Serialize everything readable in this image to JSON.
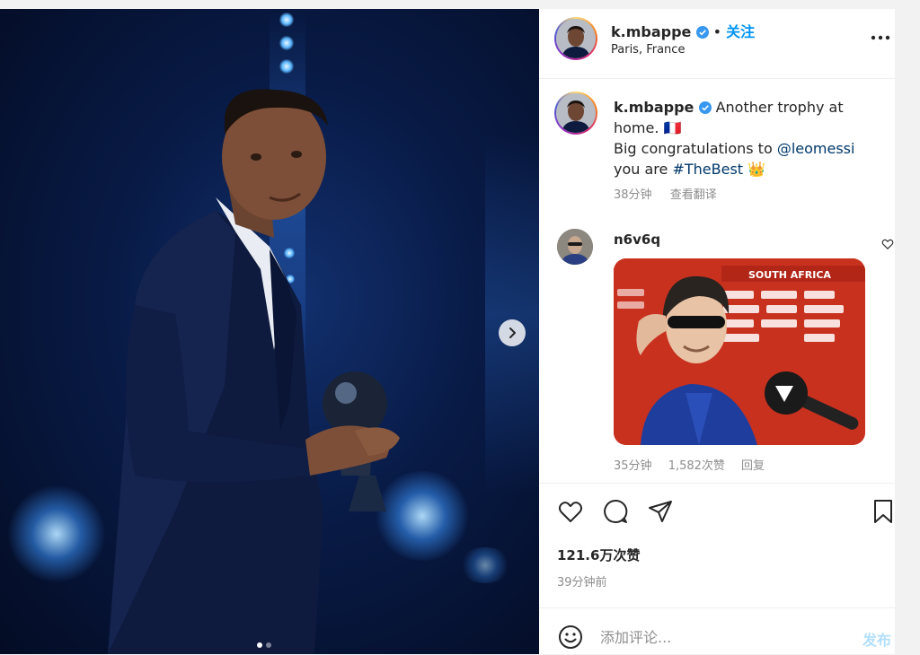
{
  "header": {
    "username": "k.mbappe",
    "separator": "•",
    "follow_label": "关注",
    "location": "Paris, France"
  },
  "caption": {
    "username": "k.mbappe",
    "line1": "Another trophy at",
    "line2": "home. 🇫🇷",
    "line3_prefix": "Big congratulations to ",
    "mention": "@leomessi",
    "line4_prefix": "you are ",
    "hashtag": "#TheBest",
    "emoji": "👑",
    "time": "38分钟",
    "translate": "查看翻译"
  },
  "comment": {
    "username": "n6v6q",
    "gif_board_text": "SOUTH AFRICA",
    "time": "35分钟",
    "likes": "1,582次赞",
    "reply": "回复"
  },
  "post": {
    "likes": "121.6万次赞",
    "time": "39分钟前"
  },
  "comment_box": {
    "placeholder": "添加评论...",
    "post_label": "发布"
  },
  "carousel": {
    "slides_total": 2,
    "active_slide": 1
  },
  "colors": {
    "link": "#00376b",
    "follow": "#0095f6",
    "muted": "#8e8e8e",
    "post_disabled": "#b2dffc",
    "verified": "#3897f0"
  },
  "icons": {
    "actions": [
      "heart-icon",
      "comment-icon",
      "share-icon",
      "bookmark-icon"
    ],
    "carousel_next": "chevron-right-icon",
    "more": "more-horizontal-icon",
    "emoji": "emoji-icon"
  }
}
